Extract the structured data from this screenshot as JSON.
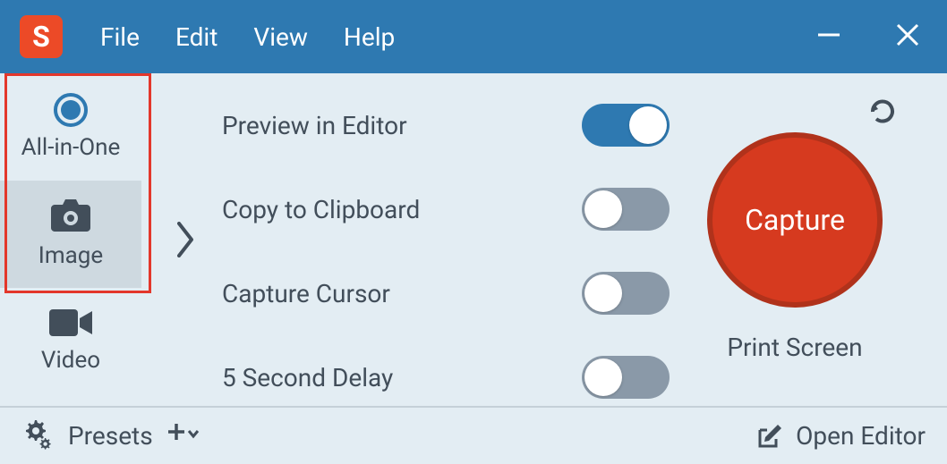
{
  "menu": {
    "file": "File",
    "edit": "Edit",
    "view": "View",
    "help": "Help"
  },
  "tabs": {
    "all_in_one": "All-in-One",
    "image": "Image",
    "video": "Video"
  },
  "settings": {
    "preview": {
      "label": "Preview in Editor",
      "on": true
    },
    "clipboard": {
      "label": "Copy to Clipboard",
      "on": false
    },
    "cursor": {
      "label": "Capture Cursor",
      "on": false
    },
    "delay": {
      "label": "5 Second Delay",
      "on": false
    }
  },
  "capture": {
    "button": "Capture",
    "hint": "Print Screen"
  },
  "footer": {
    "presets": "Presets",
    "open_editor": "Open Editor"
  },
  "logo_letter": "S"
}
